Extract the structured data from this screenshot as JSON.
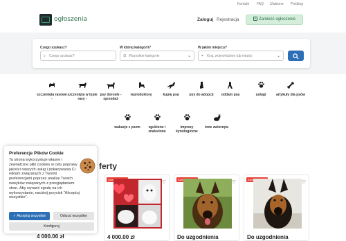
{
  "topbar": {
    "links": [
      "Kontakt",
      "FAQ",
      "Ulubione",
      "Poślbog"
    ]
  },
  "header": {
    "logo_text": "ogłoszenia",
    "login": "Zaloguj",
    "register": "Rejestracja",
    "add_button": "Zamieść ogłoszenie"
  },
  "search": {
    "what_label": "Czego szukasz?",
    "what_placeholder": "Czego szukasz?",
    "category_label": "W której kategorii?",
    "category_value": "Wszystkie kategorie",
    "where_label": "W jakim miejscu?",
    "where_placeholder": "Kraj, województwo lub miasto"
  },
  "categories": [
    {
      "label": "szczenięta rasowe -",
      "icon": "puppy-icon"
    },
    {
      "label": "szczenięta w typie rasy -",
      "icon": "dog-walk-icon"
    },
    {
      "label": "psy dorosłe - sprzedaż",
      "icon": "dog-stand-icon"
    },
    {
      "label": "reproduktory",
      "icon": "dog-icon"
    },
    {
      "label": "kupię psa",
      "icon": "dog-jump-icon"
    },
    {
      "label": "psy do adopcji",
      "icon": "dog-sit-icon"
    },
    {
      "label": "oddam psa",
      "icon": "dog-give-icon"
    },
    {
      "label": "usługi",
      "icon": "paw-icon"
    },
    {
      "label": "artykuły dla psów",
      "icon": "bone-icon"
    },
    {
      "label": "wakacje z psem",
      "icon": "paw-icon"
    },
    {
      "label": "zgubione i znalezione",
      "icon": "paw-icon"
    },
    {
      "label": "imprezy kynologiczne",
      "icon": "paw-icon"
    },
    {
      "label": "inne zwierzęta",
      "icon": "rabbit-icon"
    }
  ],
  "section": {
    "title": "ferty"
  },
  "listings": [
    {
      "badge": "Zweryfikowane",
      "price": "4 000.00 zł"
    },
    {
      "badge": "Zweryfikowane",
      "price": "Do uzgodnienia"
    },
    {
      "badge": "Zweryfikowane",
      "price": "Do uzgodnienia"
    }
  ],
  "listing_left_price": "4 000.00 zł",
  "cookie": {
    "title": "Preferencje Plików Cookie",
    "body": "Ta strona wykorzystuje własne i zewnętrzne pliki cookies w celu poprawy jakości naszych usług i pokazywania Ci reklam związanych z Twoimi preferencjami poprzez analizę Twoich nawyków związanych z przeglądaniem stron. Aby wyrazić zgodę na ich wykorzystanie, naciśnij przycisk \"Akceptuj wszystkie\".",
    "accept": "Akceptuj wszystkie",
    "reject": "Odrzuć wszystkie",
    "configure": "Konfiguruj"
  },
  "colors": {
    "brand": "#2c6e49",
    "primary": "#2c6fb6",
    "badge": "#e9423a"
  }
}
